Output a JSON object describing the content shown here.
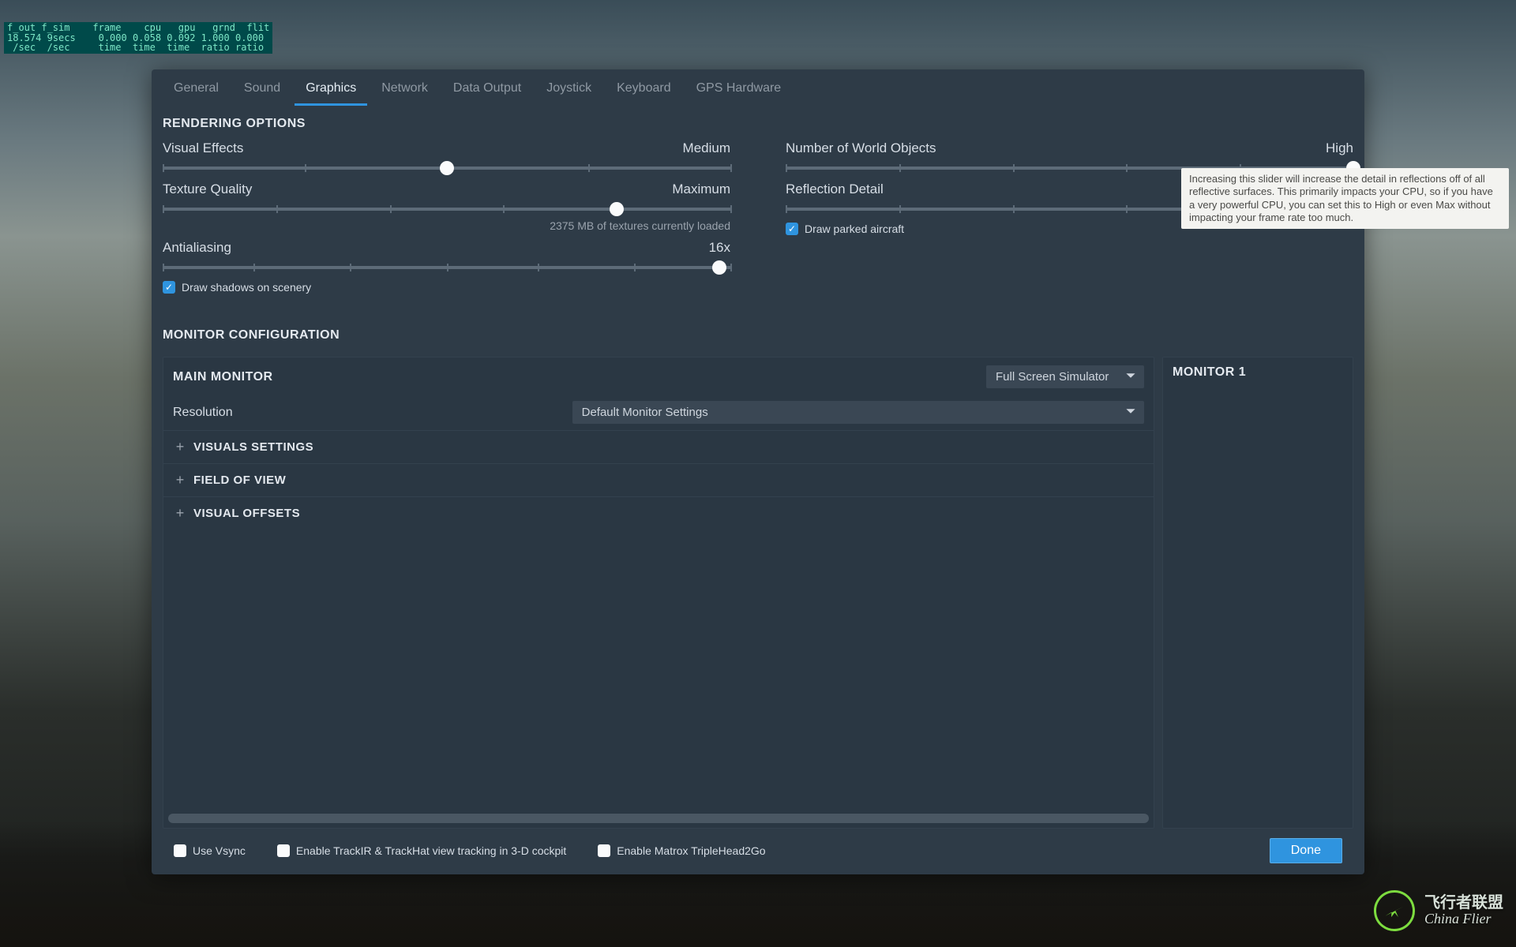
{
  "debug": "f_out f_sim    frame    cpu   gpu   grnd  flit\n18.574 9secs    0.000 0.058 0.092 1.000 0.000\n /sec  /sec     time  time  time  ratio ratio",
  "tabs": [
    {
      "label": "General",
      "active": false
    },
    {
      "label": "Sound",
      "active": false
    },
    {
      "label": "Graphics",
      "active": true
    },
    {
      "label": "Network",
      "active": false
    },
    {
      "label": "Data Output",
      "active": false
    },
    {
      "label": "Joystick",
      "active": false
    },
    {
      "label": "Keyboard",
      "active": false
    },
    {
      "label": "GPS Hardware",
      "active": false
    }
  ],
  "sections": {
    "rendering": "RENDERING OPTIONS",
    "monitor": "MONITOR CONFIGURATION"
  },
  "sliders": {
    "visual_effects": {
      "label": "Visual Effects",
      "value": "Medium",
      "pos": 50,
      "ticks": [
        0,
        25,
        50,
        75,
        100
      ]
    },
    "texture_quality": {
      "label": "Texture Quality",
      "value": "Maximum",
      "pos": 80,
      "ticks": [
        0,
        20,
        40,
        60,
        80,
        100
      ],
      "sub": "2375 MB of textures currently loaded"
    },
    "antialiasing": {
      "label": "Antialiasing",
      "value": "16x",
      "pos": 98,
      "ticks": [
        0,
        16,
        33,
        50,
        66,
        83,
        100
      ]
    },
    "world_objects": {
      "label": "Number of World Objects",
      "value": "High",
      "pos": 100,
      "ticks": [
        0,
        20,
        40,
        60,
        80,
        100
      ]
    },
    "reflection": {
      "label": "Reflection Detail",
      "value": "",
      "pos": 98,
      "ticks": [
        0,
        20,
        40,
        60,
        80,
        100
      ]
    }
  },
  "checks": {
    "shadows": {
      "label": "Draw shadows on scenery",
      "checked": true
    },
    "parked": {
      "label": "Draw parked aircraft",
      "checked": true
    },
    "vsync": {
      "label": "Use Vsync",
      "checked": false
    },
    "trackir": {
      "label": "Enable TrackIR & TrackHat view tracking in 3-D cockpit",
      "checked": false
    },
    "matrox": {
      "label": "Enable Matrox TripleHead2Go",
      "checked": false
    }
  },
  "tooltip": "Increasing this slider will increase the detail in reflections off of all reflective surfaces. This primarily impacts your CPU, so if you have a very powerful CPU, you can set this to High or even Max without impacting your frame rate too much.",
  "monitor": {
    "main_title": "MAIN MONITOR",
    "mode": "Full Screen Simulator",
    "resolution_label": "Resolution",
    "resolution_value": "Default Monitor Settings",
    "expanders": [
      {
        "label": "VISUALS SETTINGS"
      },
      {
        "label": "FIELD OF VIEW"
      },
      {
        "label": "VISUAL OFFSETS"
      }
    ],
    "side_title": "MONITOR 1"
  },
  "done": "Done",
  "watermark": {
    "cn": "飞行者联盟",
    "en": "China Flier"
  }
}
